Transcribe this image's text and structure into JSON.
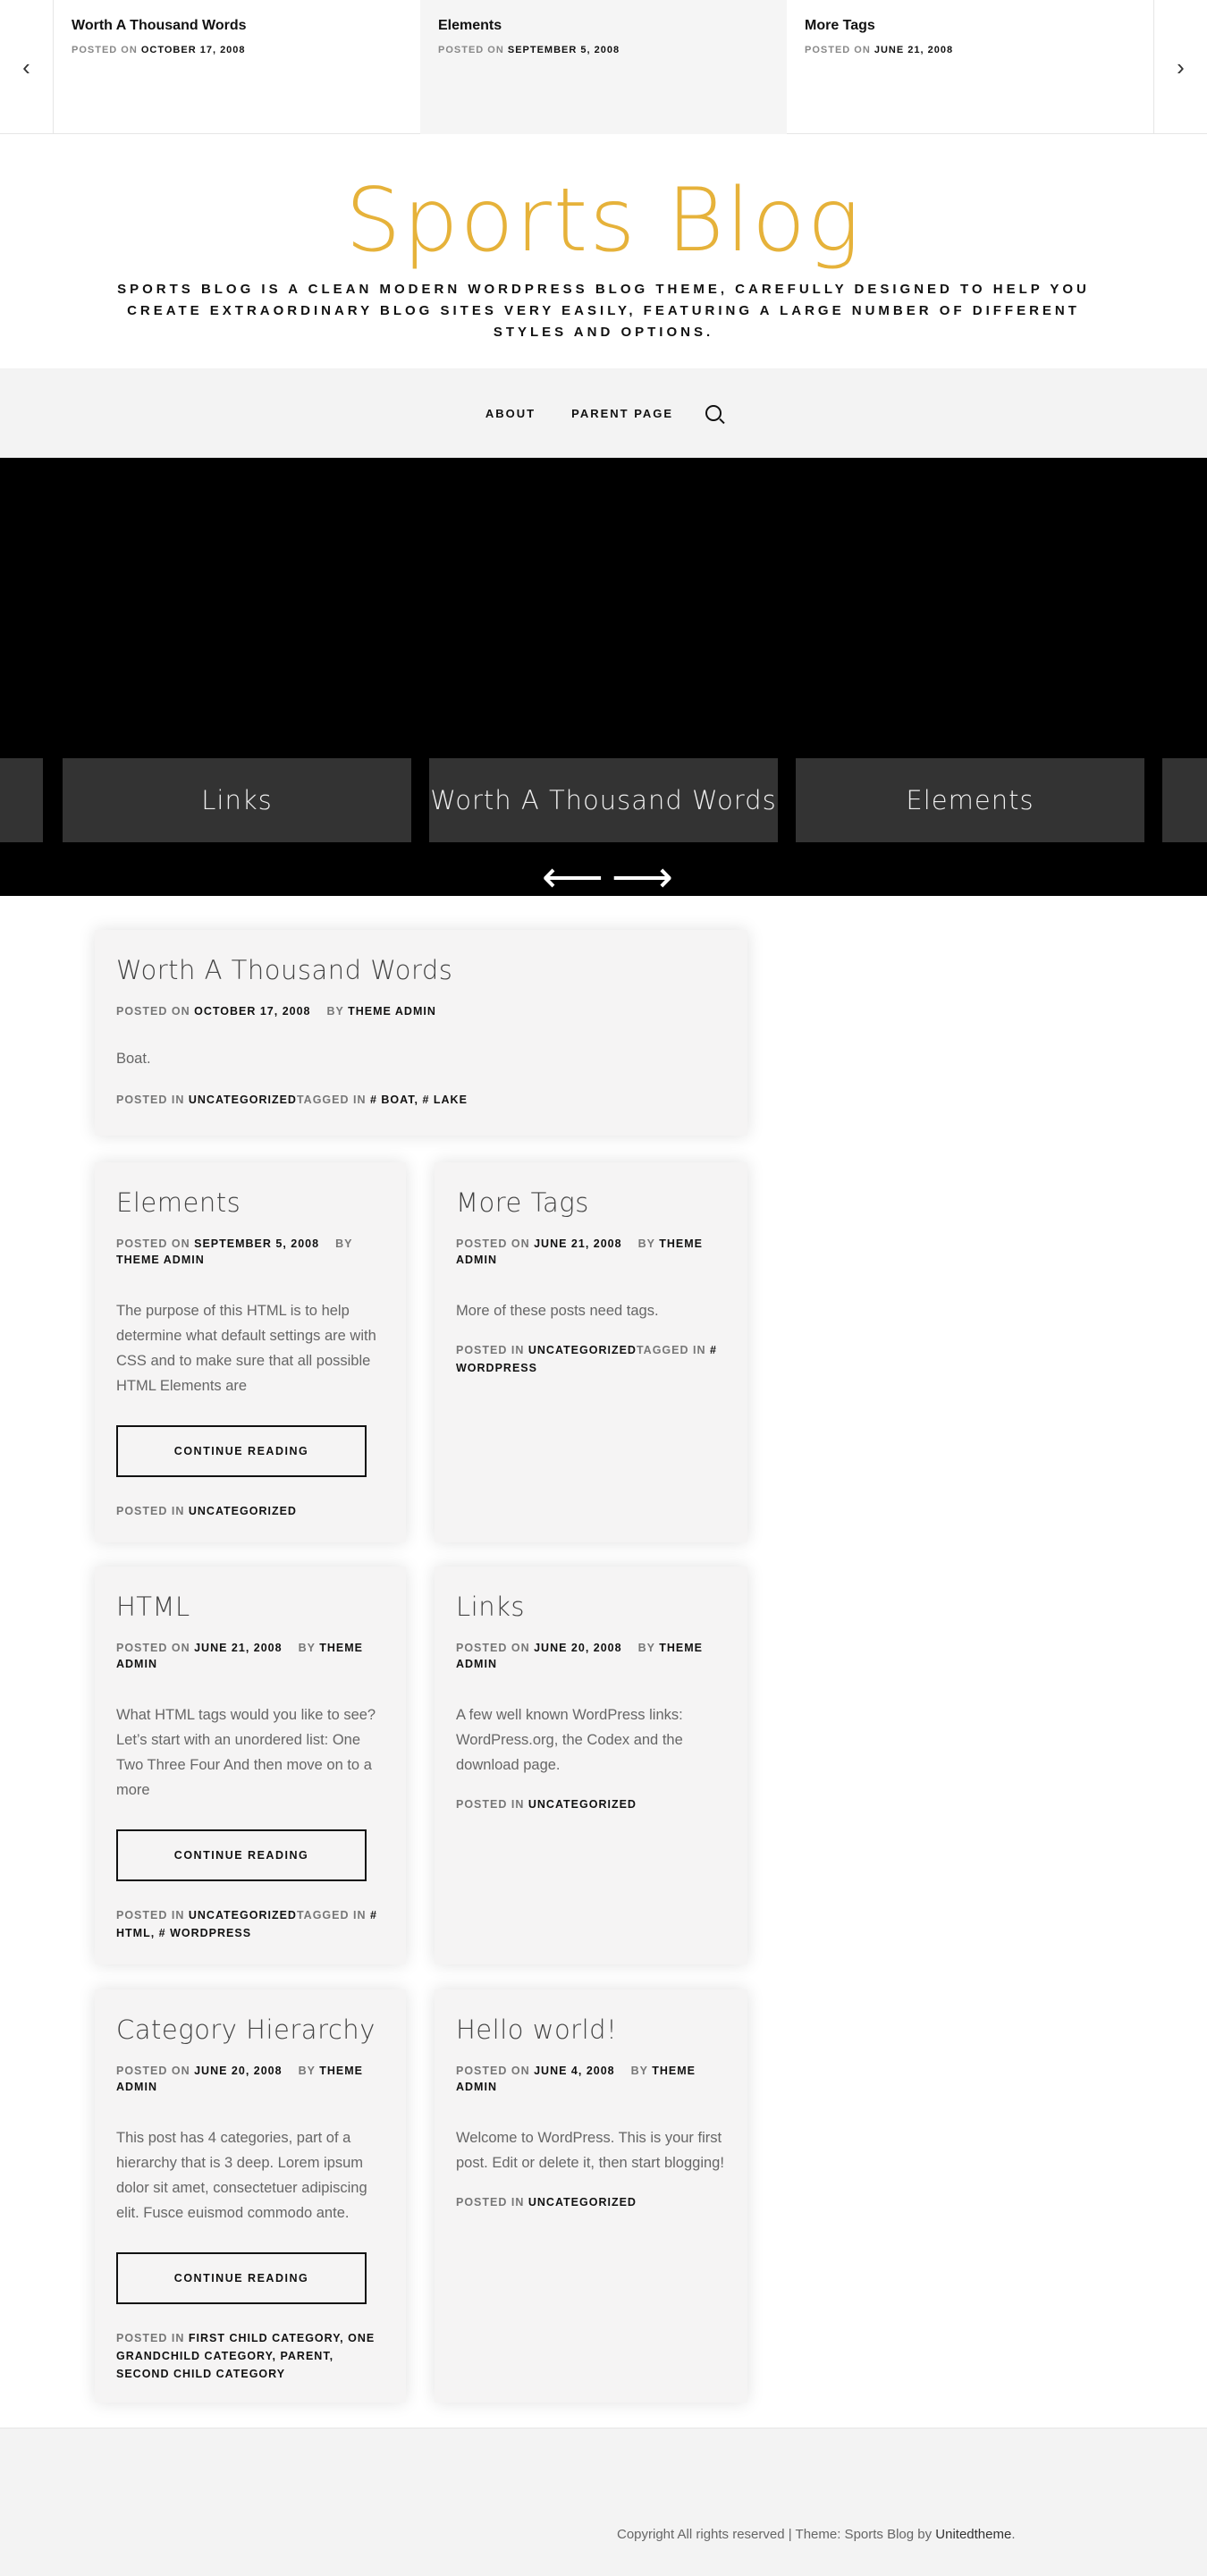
{
  "top_strip": {
    "items": [
      {
        "title": "Worth A Thousand Words",
        "meta_label": "POSTED ON",
        "date": "OCTOBER 17, 2008"
      },
      {
        "title": "Elements",
        "meta_label": "POSTED ON",
        "date": "SEPTEMBER 5, 2008"
      },
      {
        "title": "More Tags",
        "meta_label": "POSTED ON",
        "date": "JUNE 21, 2008"
      }
    ],
    "prev_arrow": "‹",
    "next_arrow": "›"
  },
  "header": {
    "site_title": "Sports Blog",
    "tagline": "Sports Blog is a clean modern WordPress blog theme, carefully designed to help you create extraordinary blog sites very easily, featuring a large number of different styles and options."
  },
  "nav": {
    "items": [
      "ABOUT",
      "PARENT PAGE"
    ],
    "search_icon": "search-icon"
  },
  "hero": {
    "slides": [
      "Links",
      "Worth A Thousand Words",
      "Elements"
    ],
    "prev_arrow": "⟵",
    "next_arrow": "⟶"
  },
  "posts": [
    {
      "title": "Worth A Thousand Words",
      "posted_on_label": "POSTED ON",
      "date": "OCTOBER 17, 2008",
      "by_label": "BY",
      "author": "THEME ADMIN",
      "excerpt": "Boat.",
      "posted_in_label": "POSTED IN",
      "categories": "UNCATEGORIZED",
      "tagged_label": "TAGGED IN",
      "tags": "# BOAT, # LAKE"
    },
    {
      "title": "Elements",
      "posted_on_label": "POSTED ON",
      "date": "SEPTEMBER 5, 2008",
      "by_label": "BY",
      "author": "THEME ADMIN",
      "excerpt": "The purpose of this HTML is to help determine what default settings are with CSS and to make sure that all possible HTML Elements are",
      "button": "CONTINUE READING",
      "posted_in_label": "POSTED IN",
      "categories": "UNCATEGORIZED"
    },
    {
      "title": "More Tags",
      "posted_on_label": "POSTED ON",
      "date": "JUNE 21, 2008",
      "by_label": "BY",
      "author": "THEME ADMIN",
      "excerpt": "More of these posts need tags.",
      "posted_in_label": "POSTED IN",
      "categories": "UNCATEGORIZED",
      "tagged_label": "TAGGED IN",
      "tags": "# WORDPRESS"
    },
    {
      "title": "HTML",
      "posted_on_label": "POSTED ON",
      "date": "JUNE 21, 2008",
      "by_label": "BY",
      "author": "THEME ADMIN",
      "excerpt": "What HTML tags would you like to see? Let’s start with an unordered list: One Two Three Four And then move on to a more",
      "button": "CONTINUE READING",
      "posted_in_label": "POSTED IN",
      "categories": "UNCATEGORIZED",
      "tagged_label": "TAGGED IN",
      "tags": "# HTML, # WORDPRESS"
    },
    {
      "title": "Links",
      "posted_on_label": "POSTED ON",
      "date": "JUNE 20, 2008",
      "by_label": "BY",
      "author": "THEME ADMIN",
      "excerpt": "A few well known WordPress links: WordPress.org, the Codex and the download page.",
      "posted_in_label": "POSTED IN",
      "categories": "UNCATEGORIZED"
    },
    {
      "title": "Category Hierarchy",
      "posted_on_label": "POSTED ON",
      "date": "JUNE 20, 2008",
      "by_label": "BY",
      "author": "THEME ADMIN",
      "excerpt": "This post has 4 categories, part of a hierarchy that is 3 deep. Lorem ipsum dolor sit amet, consectetuer adipiscing elit. Fusce euismod commodo ante.",
      "button": "CONTINUE READING",
      "posted_in_label": "POSTED IN",
      "categories": "FIRST CHILD CATEGORY, ONE GRANDCHILD CATEGORY, PARENT, SECOND CHILD CATEGORY"
    },
    {
      "title": "Hello world!",
      "posted_on_label": "POSTED ON",
      "date": "JUNE 4, 2008",
      "by_label": "BY",
      "author": "THEME ADMIN",
      "excerpt": "Welcome to WordPress. This is your first post. Edit or delete it, then start blogging!",
      "posted_in_label": "POSTED IN",
      "categories": "UNCATEGORIZED"
    }
  ],
  "footer": {
    "copyright": "Copyright All rights reserved | Theme: Sports Blog by ",
    "credit_link": "Unitedtheme",
    "end": "."
  },
  "colors": {
    "accent": "#e6b23a",
    "hero_bg": "#000000",
    "slide_bg": "#333333",
    "card_bg": "#f5f4f4"
  }
}
